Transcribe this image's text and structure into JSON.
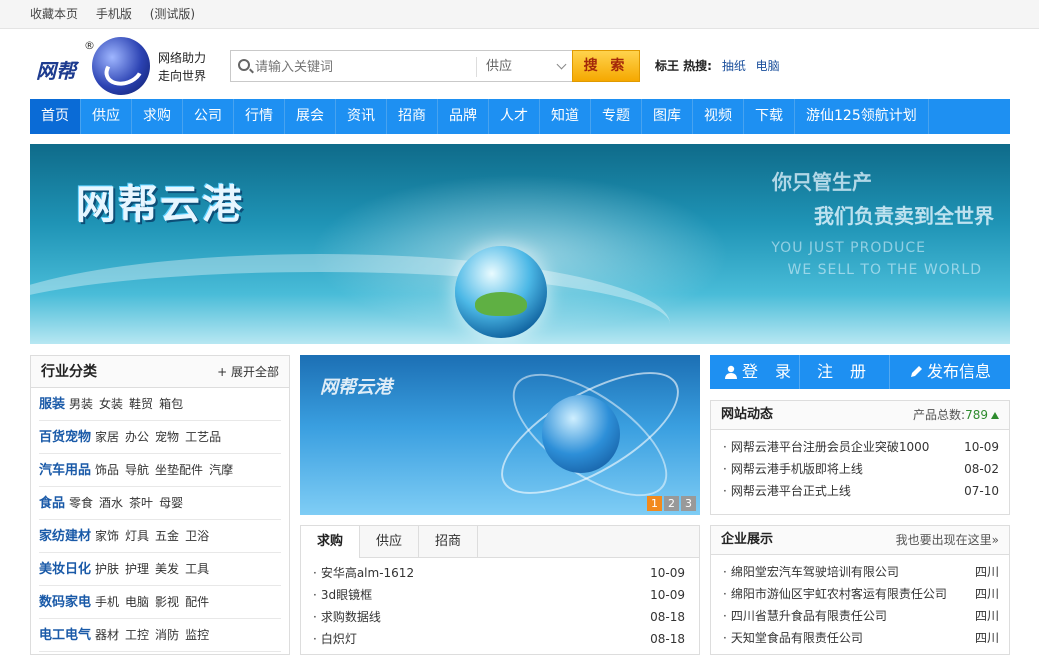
{
  "topbar": {
    "links": [
      "收藏本页",
      "手机版",
      "(测试版)"
    ]
  },
  "logo": {
    "text": "网帮",
    "registered": "®",
    "slogan_line1": "网络助力",
    "slogan_line2": "走向世界"
  },
  "search": {
    "placeholder": "请输入关键词",
    "category": "供应",
    "button": "搜 索"
  },
  "hot": {
    "label": "标王 热搜:",
    "terms": [
      "抽纸",
      "电脑"
    ]
  },
  "nav": {
    "items": [
      "首页",
      "供应",
      "求购",
      "公司",
      "行情",
      "展会",
      "资讯",
      "招商",
      "品牌",
      "人才",
      "知道",
      "专题",
      "图库",
      "视频",
      "下载",
      "游仙125领航计划"
    ]
  },
  "banner": {
    "title": "网帮云港",
    "slogan_cn_1": "你只管生产",
    "slogan_cn_2": "我们负责卖到全世界",
    "slogan_en_1": "YOU JUST PRODUCE",
    "slogan_en_2": "WE SELL TO THE WORLD"
  },
  "categories": {
    "title": "行业分类",
    "expand": "展开全部",
    "rows": [
      {
        "name": "服装",
        "subs": [
          "男装",
          "女装",
          "鞋贸",
          "箱包"
        ]
      },
      {
        "name": "百货宠物",
        "subs": [
          "家居",
          "办公",
          "宠物",
          "工艺品"
        ]
      },
      {
        "name": "汽车用品",
        "subs": [
          "饰品",
          "导航",
          "坐垫配件",
          "汽摩"
        ]
      },
      {
        "name": "食品",
        "subs": [
          "零食",
          "酒水",
          "茶叶",
          "母婴"
        ]
      },
      {
        "name": "家纺建材",
        "subs": [
          "家饰",
          "灯具",
          "五金",
          "卫浴"
        ]
      },
      {
        "name": "美妆日化",
        "subs": [
          "护肤",
          "护理",
          "美发",
          "工具"
        ]
      },
      {
        "name": "数码家电",
        "subs": [
          "手机",
          "电脑",
          "影视",
          "配件"
        ]
      },
      {
        "name": "电工电气",
        "subs": [
          "器材",
          "工控",
          "消防",
          "监控"
        ]
      }
    ]
  },
  "slider": {
    "title": "网帮云港",
    "pages": [
      "1",
      "2",
      "3"
    ]
  },
  "tabs": {
    "labels": [
      "求购",
      "供应",
      "招商"
    ],
    "items": [
      {
        "title": "安华高alm-1612",
        "date": "10-09"
      },
      {
        "title": "3d眼镜框",
        "date": "10-09"
      },
      {
        "title": "求购数据线",
        "date": "08-18"
      },
      {
        "title": "白炽灯",
        "date": "08-18"
      }
    ]
  },
  "account": {
    "login": "登 录",
    "register": "注 册",
    "publish": "发布信息"
  },
  "news": {
    "title": "网站动态",
    "total_label": "产品总数:",
    "total": "789",
    "items": [
      {
        "title": "网帮云港平台注册会员企业突破1000",
        "date": "10-09"
      },
      {
        "title": "网帮云港手机版即将上线",
        "date": "08-02"
      },
      {
        "title": "网帮云港平台正式上线",
        "date": "07-10"
      }
    ]
  },
  "companies": {
    "title": "企业展示",
    "more": "我也要出现在这里»",
    "items": [
      {
        "name": "绵阳堂宏汽车驾驶培训有限公司",
        "region": "四川"
      },
      {
        "name": "绵阳市游仙区宇虹农村客运有限责任公司",
        "region": "四川"
      },
      {
        "name": "四川省慧升食品有限责任公司",
        "region": "四川"
      },
      {
        "name": "天知堂食品有限责任公司",
        "region": "四川"
      }
    ]
  },
  "colors": {
    "nav": "#1e90f2",
    "search_button": "#f5a800",
    "category_name": "#1a5aa8"
  }
}
